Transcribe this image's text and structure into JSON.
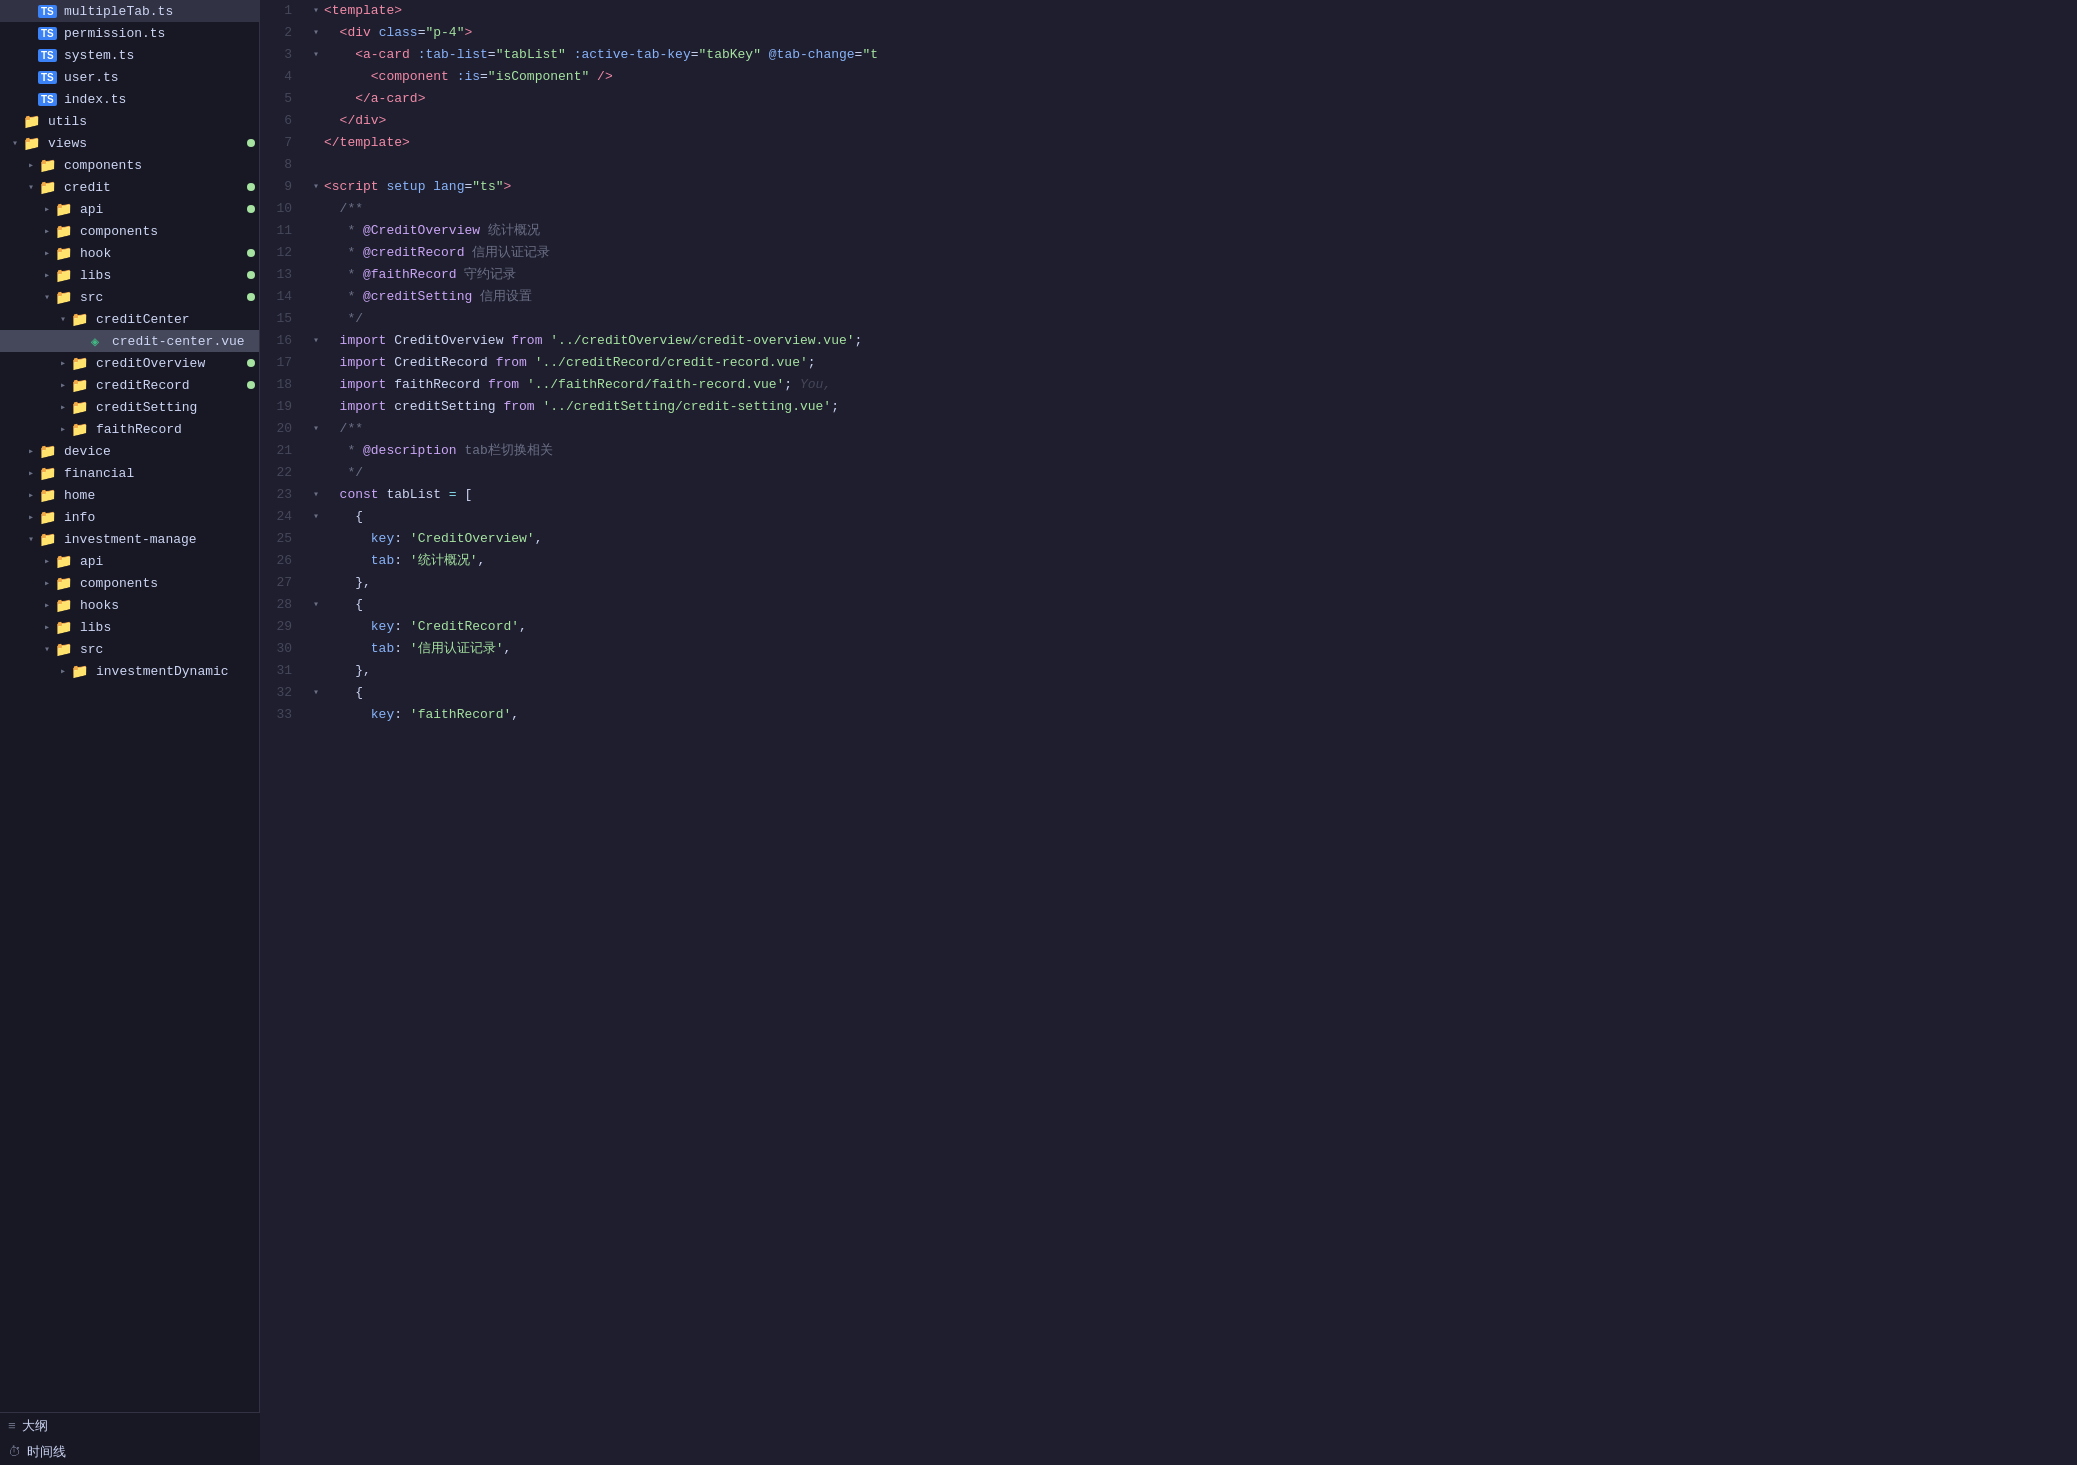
{
  "sidebar": {
    "files": [
      {
        "id": "multipleTab",
        "indent": 1,
        "type": "ts",
        "label": "multipleTab.ts",
        "dot": false
      },
      {
        "id": "permission",
        "indent": 1,
        "type": "ts",
        "label": "permission.ts",
        "dot": false
      },
      {
        "id": "system",
        "indent": 1,
        "type": "ts",
        "label": "system.ts",
        "dot": false
      },
      {
        "id": "user",
        "indent": 1,
        "type": "ts",
        "label": "user.ts",
        "dot": false
      },
      {
        "id": "index",
        "indent": 1,
        "type": "ts",
        "label": "index.ts",
        "dot": false
      },
      {
        "id": "utils",
        "indent": 0,
        "type": "folder-orange",
        "label": "utils",
        "dot": false,
        "collapsed": false,
        "arrow": ""
      },
      {
        "id": "views",
        "indent": 0,
        "type": "folder-red",
        "label": "views",
        "dot": true,
        "collapsed": false,
        "arrow": "▾"
      },
      {
        "id": "components-v",
        "indent": 1,
        "type": "folder-yellow",
        "label": "components",
        "dot": false,
        "collapsed": true,
        "arrow": "▸"
      },
      {
        "id": "credit",
        "indent": 1,
        "type": "folder-red",
        "label": "credit",
        "dot": true,
        "collapsed": false,
        "arrow": "▾"
      },
      {
        "id": "api-credit",
        "indent": 2,
        "type": "folder-green",
        "label": "api",
        "dot": true,
        "collapsed": true,
        "arrow": "▸"
      },
      {
        "id": "components-credit",
        "indent": 2,
        "type": "folder-yellow",
        "label": "components",
        "dot": false,
        "collapsed": true,
        "arrow": "▸"
      },
      {
        "id": "hook",
        "indent": 2,
        "type": "folder-yellow",
        "label": "hook",
        "dot": true,
        "collapsed": true,
        "arrow": "▸"
      },
      {
        "id": "libs",
        "indent": 2,
        "type": "folder-yellow",
        "label": "libs",
        "dot": true,
        "collapsed": true,
        "arrow": "▸"
      },
      {
        "id": "src",
        "indent": 2,
        "type": "folder-green",
        "label": "src",
        "dot": true,
        "collapsed": false,
        "arrow": "▾"
      },
      {
        "id": "creditCenter",
        "indent": 3,
        "type": "folder-yellow",
        "label": "creditCenter",
        "dot": false,
        "collapsed": false,
        "arrow": "▾"
      },
      {
        "id": "credit-center-vue",
        "indent": 4,
        "type": "vue",
        "label": "credit-center.vue",
        "dot": false,
        "active": true
      },
      {
        "id": "creditOverview",
        "indent": 3,
        "type": "folder-yellow",
        "label": "creditOverview",
        "dot": true,
        "collapsed": true,
        "arrow": "▸"
      },
      {
        "id": "creditRecord",
        "indent": 3,
        "type": "folder-yellow",
        "label": "creditRecord",
        "dot": true,
        "collapsed": true,
        "arrow": "▸"
      },
      {
        "id": "creditSetting",
        "indent": 3,
        "type": "folder-yellow",
        "label": "creditSetting",
        "dot": false,
        "collapsed": true,
        "arrow": "▸"
      },
      {
        "id": "faithRecord",
        "indent": 3,
        "type": "folder-yellow",
        "label": "faithRecord",
        "dot": false,
        "collapsed": true,
        "arrow": "▸"
      },
      {
        "id": "device",
        "indent": 1,
        "type": "folder-yellow",
        "label": "device",
        "dot": false,
        "collapsed": true,
        "arrow": "▸"
      },
      {
        "id": "financial",
        "indent": 1,
        "type": "folder-yellow",
        "label": "financial",
        "dot": false,
        "collapsed": true,
        "arrow": "▸"
      },
      {
        "id": "home",
        "indent": 1,
        "type": "folder-yellow",
        "label": "home",
        "dot": false,
        "collapsed": true,
        "arrow": "▸"
      },
      {
        "id": "info",
        "indent": 1,
        "type": "folder-yellow",
        "label": "info",
        "dot": false,
        "collapsed": true,
        "arrow": "▸"
      },
      {
        "id": "investment-manage",
        "indent": 1,
        "type": "folder-red",
        "label": "investment-manage",
        "dot": false,
        "collapsed": false,
        "arrow": "▾"
      },
      {
        "id": "api-invest",
        "indent": 2,
        "type": "folder-green",
        "label": "api",
        "dot": false,
        "collapsed": true,
        "arrow": "▸"
      },
      {
        "id": "components-invest",
        "indent": 2,
        "type": "folder-yellow",
        "label": "components",
        "dot": false,
        "collapsed": true,
        "arrow": "▸"
      },
      {
        "id": "hooks-invest",
        "indent": 2,
        "type": "folder-yellow",
        "label": "hooks",
        "dot": false,
        "collapsed": true,
        "arrow": "▸"
      },
      {
        "id": "libs-invest",
        "indent": 2,
        "type": "folder-yellow",
        "label": "libs",
        "dot": false,
        "collapsed": true,
        "arrow": "▸"
      },
      {
        "id": "src-invest",
        "indent": 2,
        "type": "folder-green",
        "label": "src",
        "dot": false,
        "collapsed": false,
        "arrow": "▾"
      },
      {
        "id": "investmentDynamic",
        "indent": 3,
        "type": "folder-yellow",
        "label": "investmentDynamic",
        "dot": false,
        "collapsed": true,
        "arrow": "▸"
      }
    ],
    "bottom_items": [
      {
        "id": "outline",
        "label": "大纲",
        "icon": "≡"
      },
      {
        "id": "timeline",
        "label": "时间线",
        "icon": "⏱"
      }
    ]
  },
  "editor": {
    "lines": [
      {
        "num": 1,
        "fold": "▾",
        "content": "<template>"
      },
      {
        "num": 2,
        "fold": "▾",
        "content": "  <div class=\"p-4\">"
      },
      {
        "num": 3,
        "fold": "▾",
        "content": "    <a-card :tab-list=\"tabList\" :active-tab-key=\"tabKey\" @tab-change=\"t"
      },
      {
        "num": 4,
        "fold": " ",
        "content": "      <component :is=\"isComponent\" />"
      },
      {
        "num": 5,
        "fold": " ",
        "content": "    </a-card>"
      },
      {
        "num": 6,
        "fold": " ",
        "content": "  </div>"
      },
      {
        "num": 7,
        "fold": " ",
        "content": "</template>"
      },
      {
        "num": 8,
        "fold": " ",
        "content": ""
      },
      {
        "num": 9,
        "fold": "▾",
        "content": "<script setup lang=\"ts\">"
      },
      {
        "num": 10,
        "fold": " ",
        "content": "  /**"
      },
      {
        "num": 11,
        "fold": " ",
        "content": "   * @CreditOverview 统计概况"
      },
      {
        "num": 12,
        "fold": " ",
        "content": "   * @creditRecord 信用认证记录"
      },
      {
        "num": 13,
        "fold": " ",
        "content": "   * @faithRecord 守约记录"
      },
      {
        "num": 14,
        "fold": " ",
        "content": "   * @creditSetting 信用设置"
      },
      {
        "num": 15,
        "fold": " ",
        "content": "   */"
      },
      {
        "num": 16,
        "fold": "▾",
        "content": "  import CreditOverview from '../creditOverview/credit-overview.vue';"
      },
      {
        "num": 17,
        "fold": " ",
        "content": "  import CreditRecord from '../creditRecord/credit-record.vue';"
      },
      {
        "num": 18,
        "fold": " ",
        "content": "  import faithRecord from '../faithRecord/faith-record.vue';",
        "ghost": "You,"
      },
      {
        "num": 19,
        "fold": " ",
        "content": "  import creditSetting from '../creditSetting/credit-setting.vue';"
      },
      {
        "num": 20,
        "fold": "▾",
        "content": "  /**"
      },
      {
        "num": 21,
        "fold": " ",
        "content": "   * @description tab栏切换相关"
      },
      {
        "num": 22,
        "fold": " ",
        "content": "   */"
      },
      {
        "num": 23,
        "fold": "▾",
        "content": "  const tabList = ["
      },
      {
        "num": 24,
        "fold": "▾",
        "content": "    {"
      },
      {
        "num": 25,
        "fold": " ",
        "content": "      key: 'CreditOverview',"
      },
      {
        "num": 26,
        "fold": " ",
        "content": "      tab: '统计概况',"
      },
      {
        "num": 27,
        "fold": " ",
        "content": "    },"
      },
      {
        "num": 28,
        "fold": "▾",
        "content": "    {"
      },
      {
        "num": 29,
        "fold": " ",
        "content": "      key: 'CreditRecord',"
      },
      {
        "num": 30,
        "fold": " ",
        "content": "      tab: '信用认证记录',"
      },
      {
        "num": 31,
        "fold": " ",
        "content": "    },"
      },
      {
        "num": 32,
        "fold": "▾",
        "content": "    {"
      },
      {
        "num": 33,
        "fold": " ",
        "content": "      key: 'faithRecord',"
      }
    ]
  },
  "colors": {
    "tag": "#f38ba8",
    "attr": "#89b4fa",
    "val": "#a6e3a1",
    "kw": "#cba6f7",
    "str": "#a6e3a1",
    "comment": "#6c7086",
    "comment_tag": "#cba6f7",
    "num": "#fab387",
    "bg": "#1e1e2e",
    "sidebar_bg": "#181825",
    "active_bg": "#45475a",
    "dot": "#a6e3a1"
  }
}
